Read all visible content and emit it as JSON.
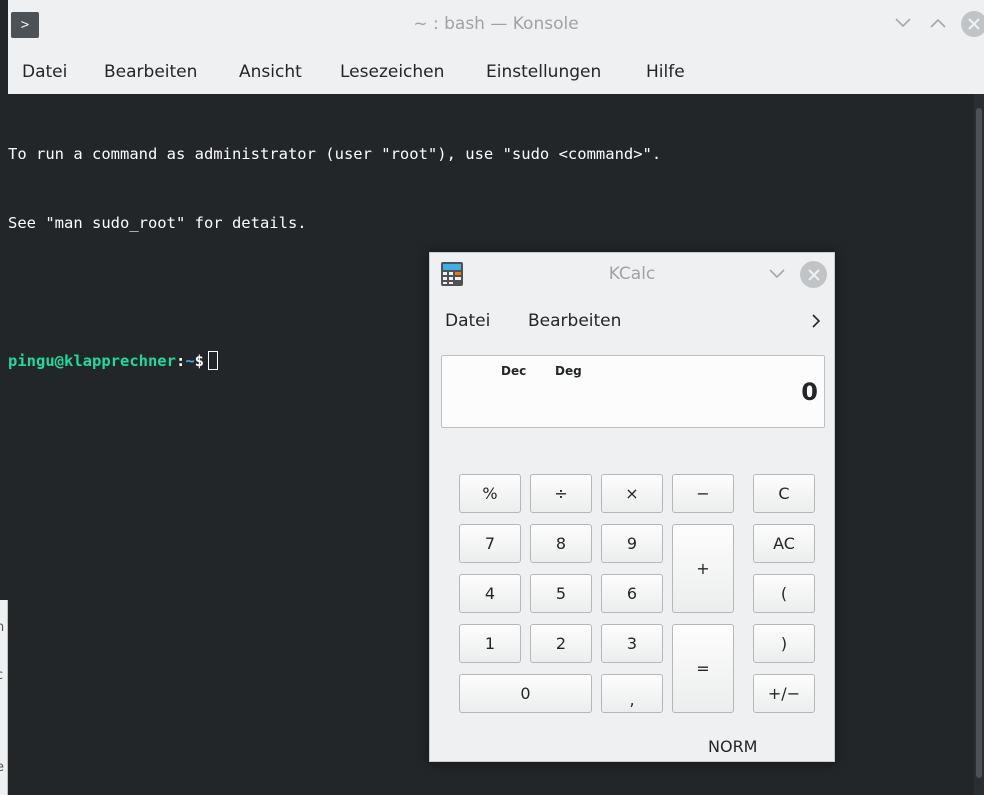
{
  "background": {
    "left_fragments": [
      "n",
      "c",
      ".",
      "e"
    ]
  },
  "konsole": {
    "title": "~ : bash — Konsole",
    "menu": [
      "Datei",
      "Bearbeiten",
      "Ansicht",
      "Lesezeichen",
      "Einstellungen",
      "Hilfe"
    ],
    "terminal": {
      "line1": "To run a command as administrator (user \"root\"), use \"sudo <command>\".",
      "line2": "See \"man sudo_root\" for details.",
      "prompt_user": "pingu@klapprechner",
      "prompt_colon": ":",
      "prompt_path": "~",
      "prompt_symbol": "$"
    },
    "icons": {
      "app": "terminal-icon",
      "minimize": "chevron-down-icon",
      "maximize": "chevron-up-icon",
      "close": "close-icon"
    }
  },
  "kcalc": {
    "title": "KCalc",
    "menu": [
      "Datei",
      "Bearbeiten"
    ],
    "display": {
      "base_indicator": "Dec",
      "angle_indicator": "Deg",
      "value": "0"
    },
    "buttons": {
      "percent": "%",
      "divide": "÷",
      "multiply": "×",
      "minus": "−",
      "clear": "C",
      "seven": "7",
      "eight": "8",
      "nine": "9",
      "plus": "+",
      "all_clear": "AC",
      "four": "4",
      "five": "5",
      "six": "6",
      "paren_open": "(",
      "one": "1",
      "two": "2",
      "three": "3",
      "equals": "=",
      "paren_close": ")",
      "zero": "0",
      "decimal": ",",
      "sign": "+/−"
    },
    "status": "NORM",
    "icons": {
      "app": "calculator-icon",
      "minimize": "chevron-down-icon",
      "close": "close-icon",
      "more": "chevron-right-icon"
    }
  }
}
